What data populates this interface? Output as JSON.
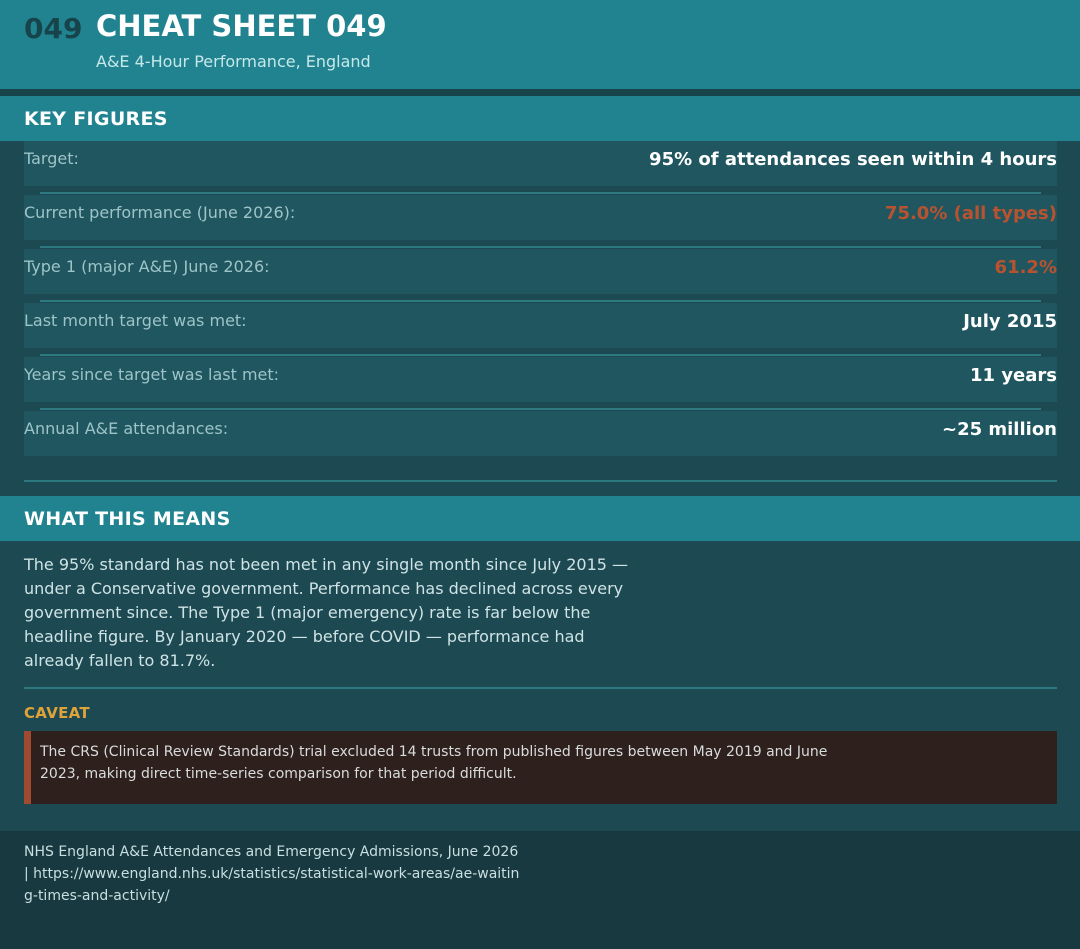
{
  "header": {
    "number": "049",
    "title": "CHEAT SHEET 049",
    "subtitle": "A&E 4-Hour Performance, England"
  },
  "key_figures": {
    "heading": "KEY FIGURES",
    "rows": [
      {
        "label": "Target:",
        "value": "95% of attendances seen within 4 hours"
      },
      {
        "label": "Current performance (June 2026):",
        "value": "75.0% (all types)"
      },
      {
        "label": "Type 1 (major A&E) June 2026:",
        "value": "61.2%"
      },
      {
        "label": "Last month target was met:",
        "value": "July 2015"
      },
      {
        "label": "Years since target was last met:",
        "value": "11 years"
      },
      {
        "label": "Annual A&E attendances:",
        "value": "~25 million"
      }
    ]
  },
  "meaning": {
    "heading": "WHAT THIS MEANS",
    "body": "The 95% standard has not been met in any single month since July 2015 — under a Conservative government. Performance has declined across every government since. The Type 1 (major emergency) rate is far below the headline figure. By January 2020 — before COVID — performance had already fallen to 81.7%."
  },
  "caveat": {
    "heading": "CAVEAT",
    "text": "The CRS (Clinical Review Standards) trial excluded 14 trusts from published figures between May 2019 and June 2023, making direct time-series comparison for that period difficult."
  },
  "footer": {
    "source": "NHS England A&E Attendances and Emergency Admissions, June 2026 | https://www.england.nhs.uk/statistics/statistical-work-areas/ae-waiting-times-and-activity/"
  },
  "colors": {
    "header_bg": "#20838f",
    "alert": "#b9532f",
    "caveat_accent": "#e0a33a"
  }
}
